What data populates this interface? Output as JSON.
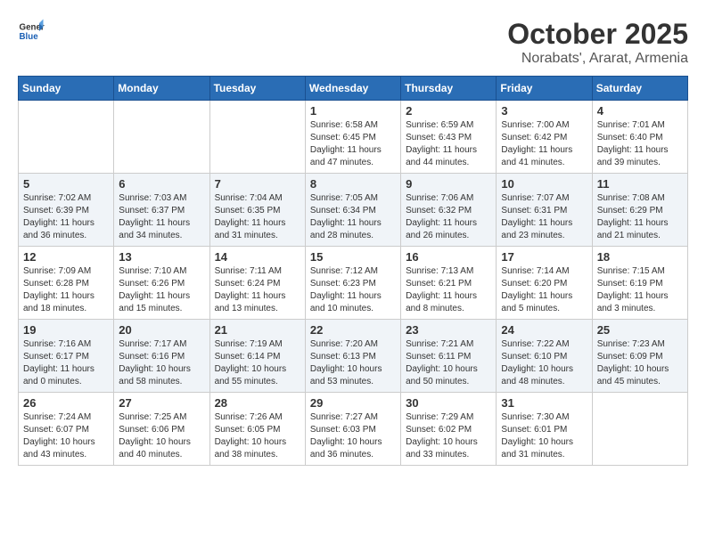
{
  "header": {
    "logo_general": "General",
    "logo_blue": "Blue",
    "month_year": "October 2025",
    "location": "Norabats', Ararat, Armenia"
  },
  "weekdays": [
    "Sunday",
    "Monday",
    "Tuesday",
    "Wednesday",
    "Thursday",
    "Friday",
    "Saturday"
  ],
  "weeks": [
    [
      {
        "day": "",
        "info": ""
      },
      {
        "day": "",
        "info": ""
      },
      {
        "day": "",
        "info": ""
      },
      {
        "day": "1",
        "info": "Sunrise: 6:58 AM\nSunset: 6:45 PM\nDaylight: 11 hours\nand 47 minutes."
      },
      {
        "day": "2",
        "info": "Sunrise: 6:59 AM\nSunset: 6:43 PM\nDaylight: 11 hours\nand 44 minutes."
      },
      {
        "day": "3",
        "info": "Sunrise: 7:00 AM\nSunset: 6:42 PM\nDaylight: 11 hours\nand 41 minutes."
      },
      {
        "day": "4",
        "info": "Sunrise: 7:01 AM\nSunset: 6:40 PM\nDaylight: 11 hours\nand 39 minutes."
      }
    ],
    [
      {
        "day": "5",
        "info": "Sunrise: 7:02 AM\nSunset: 6:39 PM\nDaylight: 11 hours\nand 36 minutes."
      },
      {
        "day": "6",
        "info": "Sunrise: 7:03 AM\nSunset: 6:37 PM\nDaylight: 11 hours\nand 34 minutes."
      },
      {
        "day": "7",
        "info": "Sunrise: 7:04 AM\nSunset: 6:35 PM\nDaylight: 11 hours\nand 31 minutes."
      },
      {
        "day": "8",
        "info": "Sunrise: 7:05 AM\nSunset: 6:34 PM\nDaylight: 11 hours\nand 28 minutes."
      },
      {
        "day": "9",
        "info": "Sunrise: 7:06 AM\nSunset: 6:32 PM\nDaylight: 11 hours\nand 26 minutes."
      },
      {
        "day": "10",
        "info": "Sunrise: 7:07 AM\nSunset: 6:31 PM\nDaylight: 11 hours\nand 23 minutes."
      },
      {
        "day": "11",
        "info": "Sunrise: 7:08 AM\nSunset: 6:29 PM\nDaylight: 11 hours\nand 21 minutes."
      }
    ],
    [
      {
        "day": "12",
        "info": "Sunrise: 7:09 AM\nSunset: 6:28 PM\nDaylight: 11 hours\nand 18 minutes."
      },
      {
        "day": "13",
        "info": "Sunrise: 7:10 AM\nSunset: 6:26 PM\nDaylight: 11 hours\nand 15 minutes."
      },
      {
        "day": "14",
        "info": "Sunrise: 7:11 AM\nSunset: 6:24 PM\nDaylight: 11 hours\nand 13 minutes."
      },
      {
        "day": "15",
        "info": "Sunrise: 7:12 AM\nSunset: 6:23 PM\nDaylight: 11 hours\nand 10 minutes."
      },
      {
        "day": "16",
        "info": "Sunrise: 7:13 AM\nSunset: 6:21 PM\nDaylight: 11 hours\nand 8 minutes."
      },
      {
        "day": "17",
        "info": "Sunrise: 7:14 AM\nSunset: 6:20 PM\nDaylight: 11 hours\nand 5 minutes."
      },
      {
        "day": "18",
        "info": "Sunrise: 7:15 AM\nSunset: 6:19 PM\nDaylight: 11 hours\nand 3 minutes."
      }
    ],
    [
      {
        "day": "19",
        "info": "Sunrise: 7:16 AM\nSunset: 6:17 PM\nDaylight: 11 hours\nand 0 minutes."
      },
      {
        "day": "20",
        "info": "Sunrise: 7:17 AM\nSunset: 6:16 PM\nDaylight: 10 hours\nand 58 minutes."
      },
      {
        "day": "21",
        "info": "Sunrise: 7:19 AM\nSunset: 6:14 PM\nDaylight: 10 hours\nand 55 minutes."
      },
      {
        "day": "22",
        "info": "Sunrise: 7:20 AM\nSunset: 6:13 PM\nDaylight: 10 hours\nand 53 minutes."
      },
      {
        "day": "23",
        "info": "Sunrise: 7:21 AM\nSunset: 6:11 PM\nDaylight: 10 hours\nand 50 minutes."
      },
      {
        "day": "24",
        "info": "Sunrise: 7:22 AM\nSunset: 6:10 PM\nDaylight: 10 hours\nand 48 minutes."
      },
      {
        "day": "25",
        "info": "Sunrise: 7:23 AM\nSunset: 6:09 PM\nDaylight: 10 hours\nand 45 minutes."
      }
    ],
    [
      {
        "day": "26",
        "info": "Sunrise: 7:24 AM\nSunset: 6:07 PM\nDaylight: 10 hours\nand 43 minutes."
      },
      {
        "day": "27",
        "info": "Sunrise: 7:25 AM\nSunset: 6:06 PM\nDaylight: 10 hours\nand 40 minutes."
      },
      {
        "day": "28",
        "info": "Sunrise: 7:26 AM\nSunset: 6:05 PM\nDaylight: 10 hours\nand 38 minutes."
      },
      {
        "day": "29",
        "info": "Sunrise: 7:27 AM\nSunset: 6:03 PM\nDaylight: 10 hours\nand 36 minutes."
      },
      {
        "day": "30",
        "info": "Sunrise: 7:29 AM\nSunset: 6:02 PM\nDaylight: 10 hours\nand 33 minutes."
      },
      {
        "day": "31",
        "info": "Sunrise: 7:30 AM\nSunset: 6:01 PM\nDaylight: 10 hours\nand 31 minutes."
      },
      {
        "day": "",
        "info": ""
      }
    ]
  ]
}
